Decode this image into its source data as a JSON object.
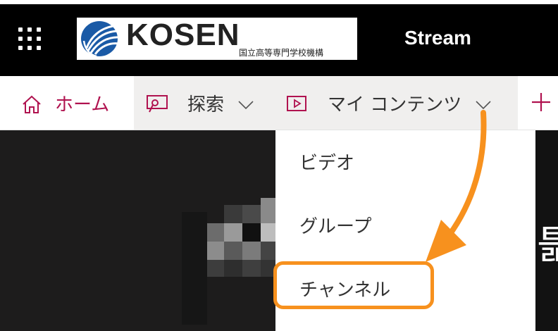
{
  "header": {
    "waffle_icon": "waffle-grid-icon",
    "logo": {
      "text": "KOSEN",
      "subtitle": "国立高等専門学校機構",
      "brand_colors": {
        "blue": "#1a5aa6",
        "text": "#222222"
      }
    },
    "app_title": "Stream"
  },
  "nav": {
    "home_label": "ホーム",
    "home_icon": "home-icon",
    "explore_label": "探索",
    "explore_icon": "explore-search-icon",
    "my_content_label": "マイ コンテンツ",
    "my_content_icon": "video-play-icon",
    "create_icon": "plus-icon",
    "accent_color": "#b0124f"
  },
  "dropdown": {
    "items": [
      {
        "label": "ビデオ"
      },
      {
        "label": "グループ"
      },
      {
        "label": "チャンネル"
      }
    ]
  },
  "content": {
    "partial_char": "틂"
  },
  "annotation": {
    "highlight_color": "#f7911e"
  }
}
